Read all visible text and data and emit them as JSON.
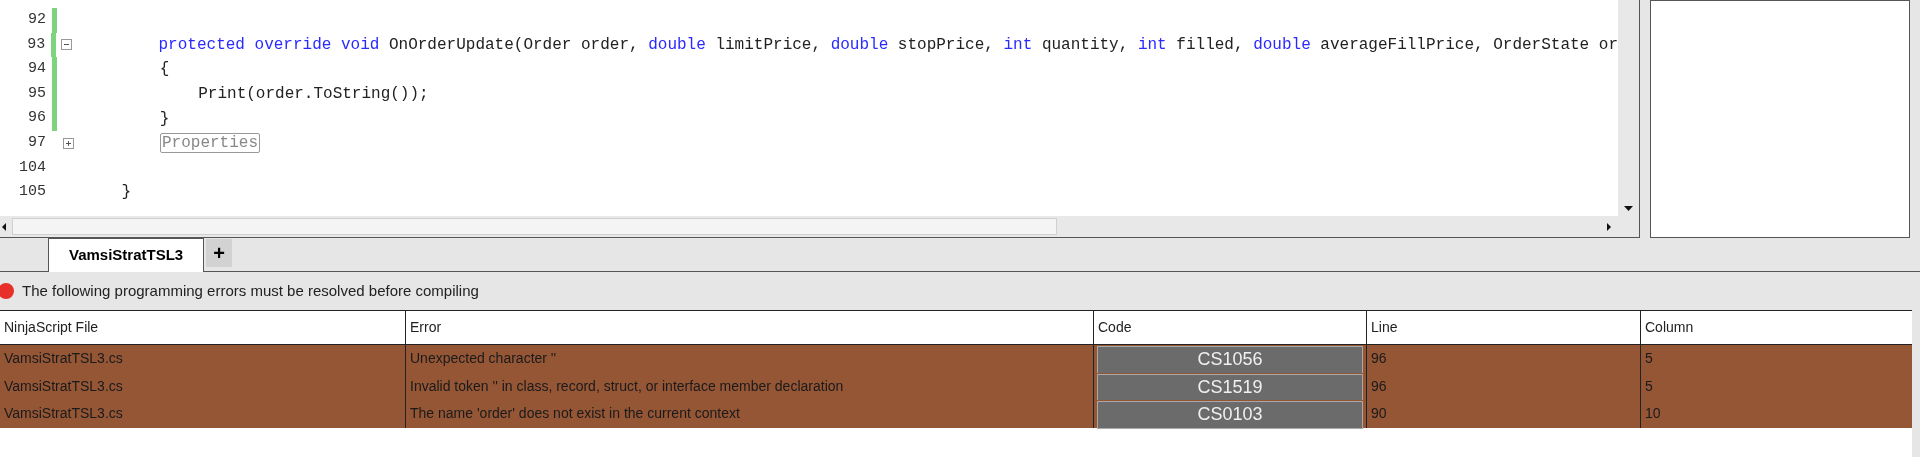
{
  "editor": {
    "lines": [
      {
        "number": "92",
        "changed": true
      },
      {
        "number": "93",
        "changed": true,
        "foldable": true,
        "expanded": true,
        "tokens": [
          {
            "kind": "keyword",
            "text": "        protected "
          },
          {
            "kind": "keyword",
            "text": "override "
          },
          {
            "kind": "keyword",
            "text": "void"
          },
          {
            "kind": "plain",
            "text": " OnOrderUpdate(Order order, "
          },
          {
            "kind": "keyword",
            "text": "double"
          },
          {
            "kind": "plain",
            "text": " limitPrice, "
          },
          {
            "kind": "keyword",
            "text": "double"
          },
          {
            "kind": "plain",
            "text": " stopPrice, "
          },
          {
            "kind": "keyword",
            "text": "int"
          },
          {
            "kind": "plain",
            "text": " quantity, "
          },
          {
            "kind": "keyword",
            "text": "int"
          },
          {
            "kind": "plain",
            "text": " filled, "
          },
          {
            "kind": "keyword",
            "text": "double"
          },
          {
            "kind": "plain",
            "text": " averageFillPrice, OrderState or"
          }
        ]
      },
      {
        "number": "94",
        "changed": true,
        "tokens": [
          {
            "kind": "plain",
            "text": "        {"
          }
        ]
      },
      {
        "number": "95",
        "changed": true,
        "tokens": [
          {
            "kind": "plain",
            "text": "            Print(order.ToString());"
          }
        ]
      },
      {
        "number": "96",
        "changed": true,
        "tokens": [
          {
            "kind": "plain",
            "text": "        }"
          }
        ]
      },
      {
        "number": "97",
        "changed": false,
        "foldable": true,
        "expanded": false,
        "tokens": [
          {
            "kind": "region",
            "text": "Properties"
          }
        ]
      },
      {
        "number": "104",
        "changed": false
      },
      {
        "number": "105",
        "changed": false,
        "tokens": [
          {
            "kind": "plain",
            "text": "    }"
          }
        ]
      }
    ]
  },
  "tabs": [
    {
      "label": "VamsiStratTSL3",
      "selected": true
    },
    {
      "label": "+",
      "selected": false
    }
  ],
  "error_banner": {
    "text": "The following programming errors must be resolved before compiling"
  },
  "table": {
    "columns": [
      "NinjaScript File",
      "Error",
      "Code",
      "Line",
      "Column"
    ],
    "rows": [
      [
        "VamsiStratTSL3.cs",
        "Unexpected character ''",
        "CS1056",
        "96",
        "5"
      ],
      [
        "VamsiStratTSL3.cs",
        "Invalid token '' in class, record, struct, or interface member declaration",
        "CS1519",
        "96",
        "5"
      ],
      [
        "VamsiStratTSL3.cs",
        "The name 'order' does not exist in the current context",
        "CS0103",
        "90",
        "10"
      ]
    ]
  }
}
